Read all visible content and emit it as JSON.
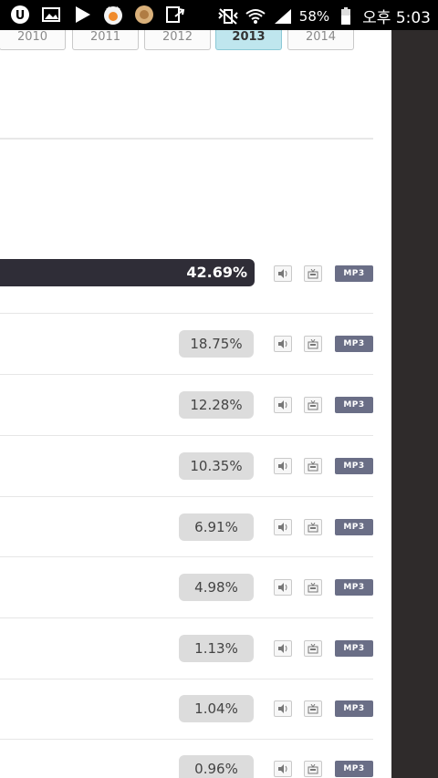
{
  "status_bar": {
    "battery": "58%",
    "time": "오후 5:03"
  },
  "years": [
    {
      "label": "2010",
      "active": false
    },
    {
      "label": "2011",
      "active": false
    },
    {
      "label": "2012",
      "active": false
    },
    {
      "label": "2013",
      "active": true
    },
    {
      "label": "2014",
      "active": false
    }
  ],
  "rows": [
    {
      "percent": "42.69%",
      "mp3_label": "MP3"
    },
    {
      "percent": "18.75%",
      "mp3_label": "MP3"
    },
    {
      "percent": "12.28%",
      "mp3_label": "MP3"
    },
    {
      "percent": "10.35%",
      "mp3_label": "MP3"
    },
    {
      "percent": "6.91%",
      "mp3_label": "MP3"
    },
    {
      "percent": "4.98%",
      "mp3_label": "MP3"
    },
    {
      "percent": "1.13%",
      "mp3_label": "MP3"
    },
    {
      "percent": "1.04%",
      "mp3_label": "MP3"
    },
    {
      "percent": "0.96%",
      "mp3_label": "MP3"
    }
  ]
}
